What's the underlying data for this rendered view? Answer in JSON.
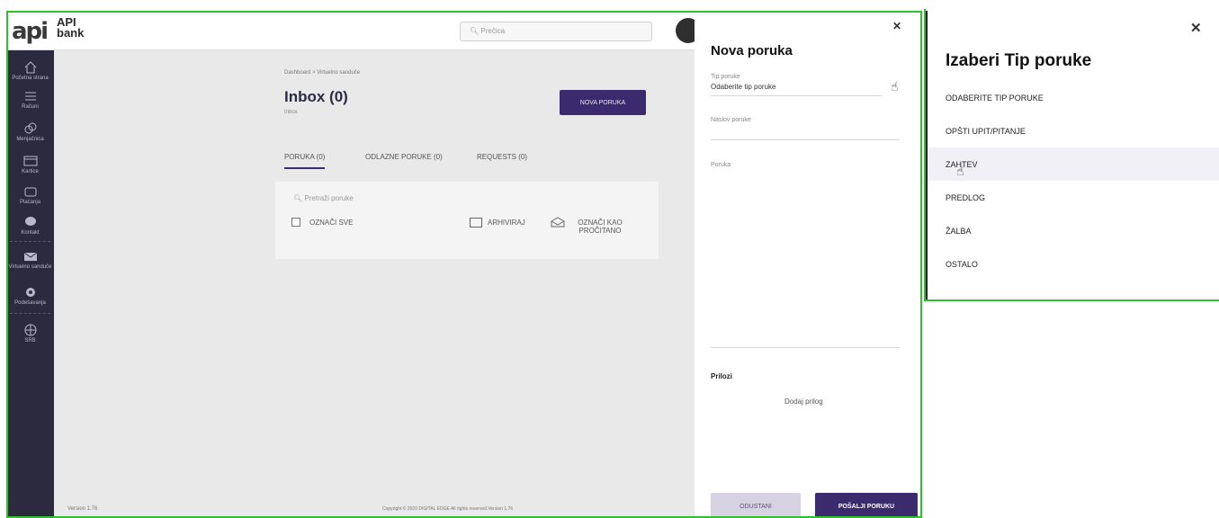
{
  "topbar": {
    "logo_mark": "api",
    "logo_line1": "API",
    "logo_line2": "bank",
    "search_placeholder": "Prečica"
  },
  "sidebar": {
    "items": [
      {
        "label": "Početna strana",
        "icon": "home-icon"
      },
      {
        "label": "Računi",
        "icon": "list-icon"
      },
      {
        "label": "Menjačnica",
        "icon": "exchange-icon"
      },
      {
        "label": "Kartice",
        "icon": "card-icon"
      },
      {
        "label": "Plaćanja",
        "icon": "wallet-icon"
      },
      {
        "label": "Kontakt",
        "icon": "chat-icon"
      },
      {
        "label": "Virtuelno sanduče",
        "icon": "mail-icon"
      },
      {
        "label": "Podešavanja",
        "icon": "gear-icon"
      },
      {
        "label": "SRB",
        "icon": "globe-icon"
      }
    ]
  },
  "main": {
    "breadcrumb": "Dashboard  >  Virtuelno sanduče",
    "title": "Inbox (0)",
    "subtitle": "Inbox",
    "new_message_button": "NOVA PORUKA",
    "tabs": [
      {
        "label": "PORUKA (0)",
        "active": true
      },
      {
        "label": "ODLAZNE PORUKE (0)",
        "active": false
      },
      {
        "label": "REQUESTS (0)",
        "active": false
      }
    ],
    "search_placeholder": "Pretraži poruke",
    "select_all": "OZNAČI SVE",
    "archive": "ARHIVIRAJ",
    "mark_read": "OZNAČI KAO PROČITANO"
  },
  "footer": {
    "version": "Version 1.76",
    "copyright": "Copyright © 2020 DIGITAL EDGE All rights reserved.Version 1.76"
  },
  "modal": {
    "title": "Nova poruka",
    "type_label": "Tip poruke",
    "type_value": "Odaberite tip poruke",
    "subject_label": "Naslov poruke",
    "message_label": "Poruka",
    "attachments_label": "Prilozi",
    "add_attachment": "Dodaj prilog",
    "cancel_button": "ODUSTANI",
    "send_button": "POŠALJI PORUKU"
  },
  "dropdown": {
    "title": "Izaberi Tip poruke",
    "options": [
      "ODABERITE TIP PORUKE",
      "OPŠTI UPIT/PITANJE",
      "ZAHTEV",
      "PREDLOG",
      "ŽALBA",
      "OSTALO"
    ],
    "hovered_option": "ZAHTEV"
  },
  "colors": {
    "primary": "#3b2a6d",
    "sidebar_bg": "#2b2a3f",
    "highlight_frame": "#2ec02e"
  }
}
